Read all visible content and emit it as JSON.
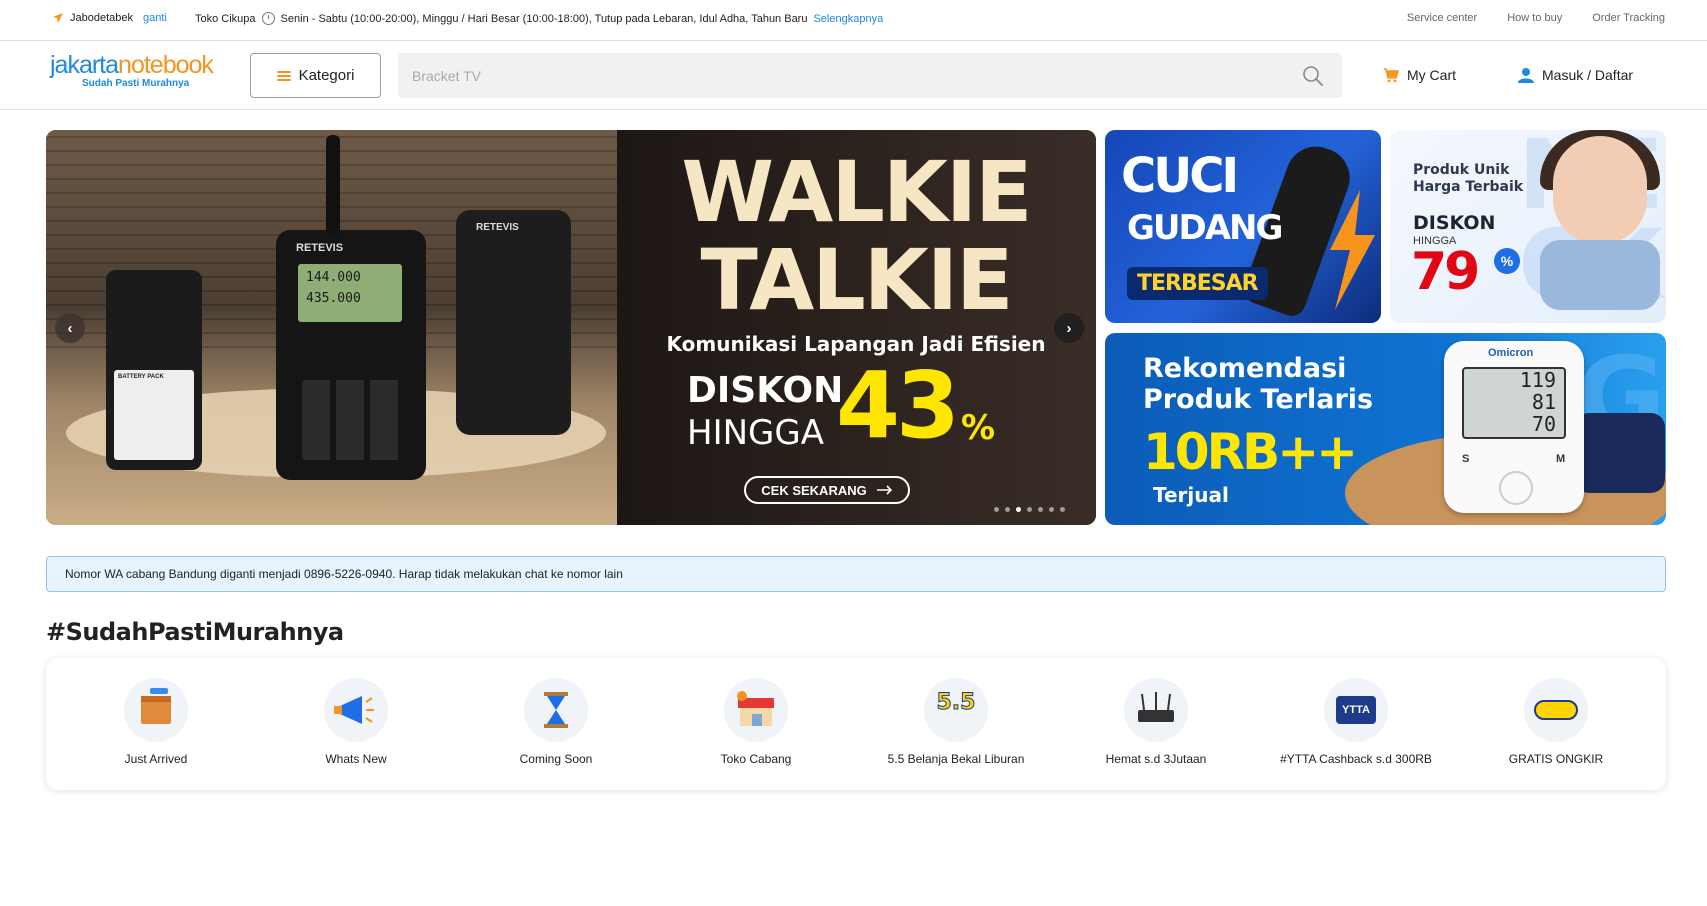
{
  "topbar": {
    "location": "Jabodetabek",
    "change_label": "ganti",
    "store": "Toko Cikupa",
    "hours": "Senin - Sabtu (10:00-20:00), Minggu / Hari Besar (10:00-18:00), Tutup pada Lebaran, Idul Adha, Tahun Baru",
    "more_label": "Selengkapnya",
    "links": [
      "Service center",
      "How to buy",
      "Order Tracking"
    ]
  },
  "header": {
    "logo_text_a": "jakarta",
    "logo_text_b": "notebook",
    "logo_tagline": "Sudah Pasti Murahnya",
    "category_label": "Kategori",
    "search_placeholder": "Bracket TV",
    "cart_label": "My Cart",
    "login_label": "Masuk / Daftar"
  },
  "hero": {
    "title_line1": "WALKIE",
    "title_line2": "TALKIE",
    "subtitle": "Komunikasi Lapangan Jadi Efisien",
    "discount_label": "DISKON",
    "upto_label": "HINGGA",
    "discount_value": "43",
    "percent_sign": "%",
    "cta_label": "CEK SEKARANG",
    "radio_brand": "RETEVIS",
    "radio_freq1": "144.000",
    "radio_freq2": "435.000",
    "battery_label": "BATTERY PACK",
    "slide_count": 7,
    "active_slide": 3
  },
  "banners": {
    "cuci": {
      "line1": "CUCI",
      "line2": "GUDANG",
      "line3": "TERBESAR"
    },
    "produk": {
      "line1": "Produk Unik",
      "line2": "Harga Terbaik",
      "discount": "DISKON",
      "upto": "HINGGA",
      "value": "79",
      "percent": "%"
    },
    "rekom": {
      "line1": "Rekomendasi",
      "line2": "Produk Terlaris",
      "value": "10RB++",
      "sold": "Terjual",
      "device_brand": "Omicron",
      "sys": "119",
      "dia": "81",
      "pulse": "70",
      "left_btn": "S",
      "right_btn": "M"
    }
  },
  "notice": "Nomor WA cabang Bandung diganti menjadi 0896-5226-0940. Harap tidak melakukan chat ke nomor lain",
  "section_title": "#SudahPastiMurahnya",
  "categories": [
    {
      "label": "Just Arrived",
      "icon": "box-icon"
    },
    {
      "label": "Whats New",
      "icon": "megaphone-icon"
    },
    {
      "label": "Coming Soon",
      "icon": "hourglass-icon"
    },
    {
      "label": "Toko Cabang",
      "icon": "store-icon"
    },
    {
      "label": "5.5 Belanja Bekal Liburan",
      "icon": "promo-55-icon"
    },
    {
      "label": "Hemat s.d 3Jutaan",
      "icon": "router-icon"
    },
    {
      "label": "#YTTA Cashback s.d 300RB",
      "icon": "ytta-icon"
    },
    {
      "label": "GRATIS ONGKIR",
      "icon": "free-shipping-icon"
    }
  ],
  "colors": {
    "brand_blue": "#1e88e5",
    "brand_orange": "#f7941d",
    "promo_yellow": "#ffe600",
    "promo_red": "#e30613"
  }
}
